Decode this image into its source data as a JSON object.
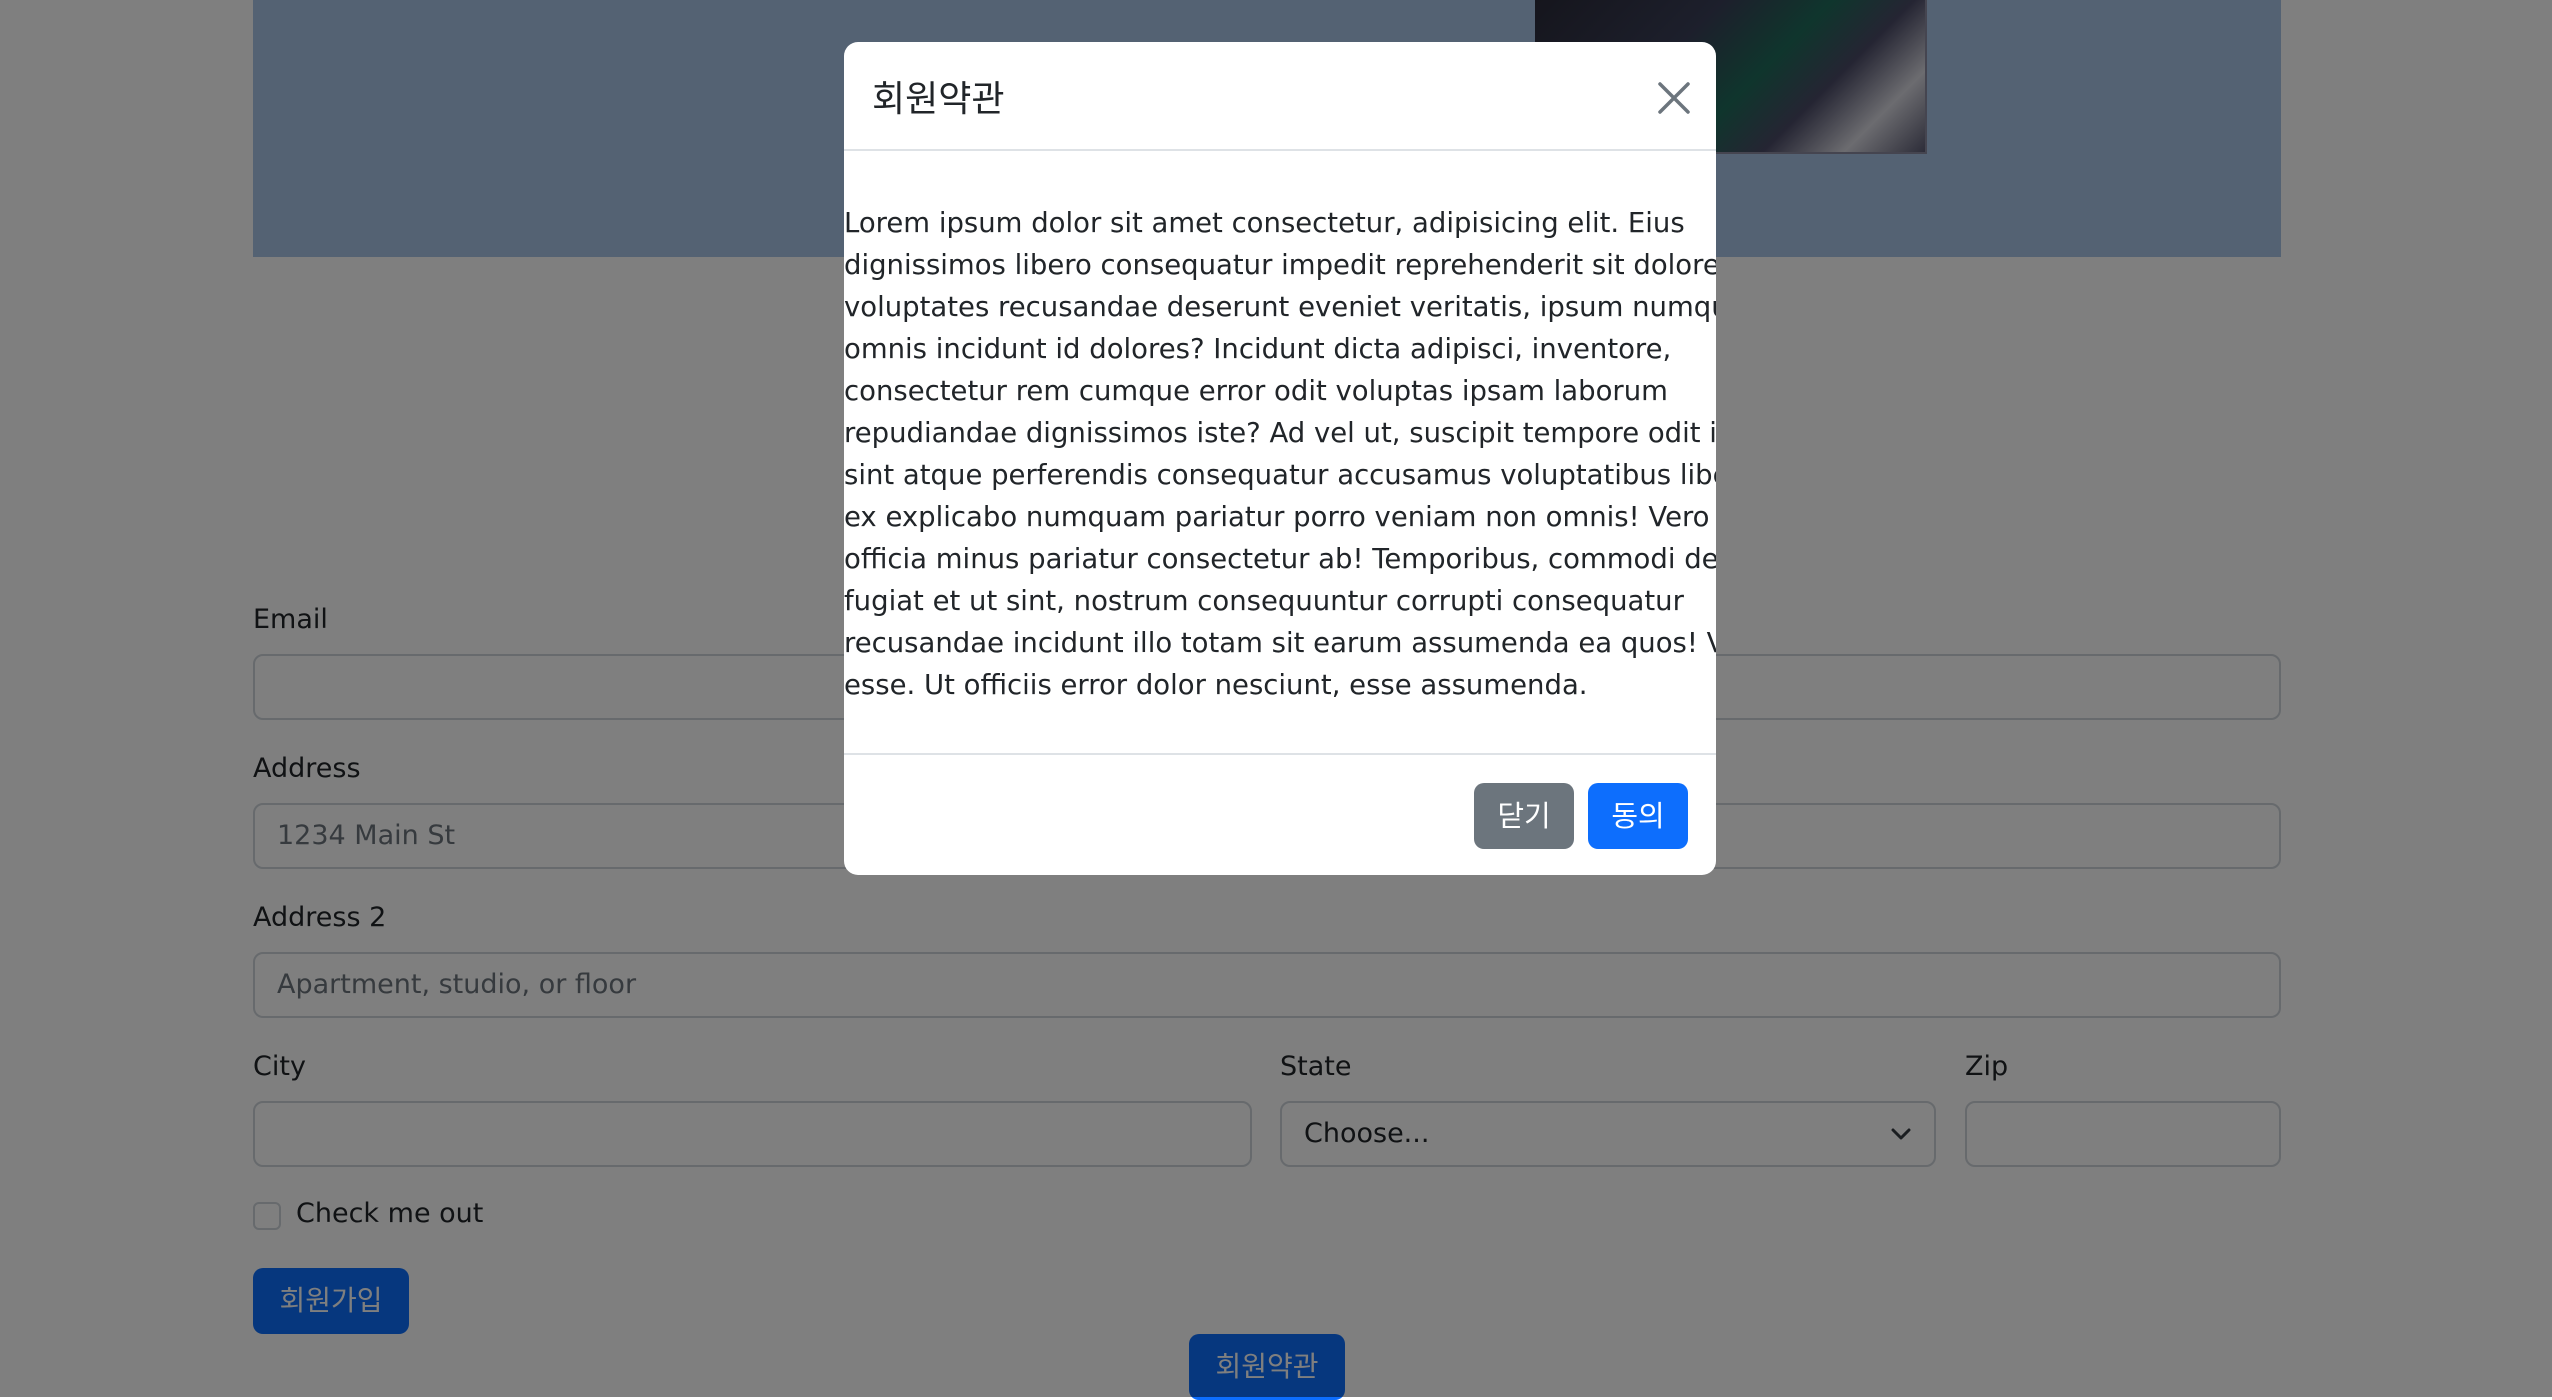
{
  "form": {
    "email_label": "Email",
    "email_value": "",
    "address_label": "Address",
    "address_placeholder": "1234 Main St",
    "address2_label": "Address 2",
    "address2_placeholder": "Apartment, studio, or floor",
    "city_label": "City",
    "city_value": "",
    "state_label": "State",
    "state_selected": "Choose...",
    "zip_label": "Zip",
    "zip_value": "",
    "checkbox_label": "Check me out",
    "checkbox_checked": false,
    "signup_button": "회원가입",
    "terms_button": "회원약관"
  },
  "modal": {
    "title": "회원약관",
    "body_lines": [
      "Lorem ipsum dolor sit amet consectetur, adipisicing elit. Eius",
      "dignissimos libero consequatur impedit reprehenderit sit dolore",
      "voluptates recusandae deserunt eveniet veritatis, ipsum numquam",
      "omnis incidunt id dolores? Incidunt dicta adipisci, inventore,",
      "consectetur rem cumque error odit voluptas ipsam laborum",
      "repudiandae dignissimos iste? Ad vel ut, suscipit tempore odit id",
      "sint atque perferendis consequatur accusamus voluptatibus libero",
      "ex explicabo numquam pariatur porro veniam non omnis! Vero odio",
      "officia minus pariatur consectetur ab! Temporibus, commodi deleniti",
      "fugiat et ut sint, nostrum consequuntur corrupti consequatur",
      "recusandae incidunt illo totam sit earum assumenda ea quos! Vel,",
      "esse. Ut officiis error dolor nesciunt, esse assumenda."
    ],
    "close_button": "닫기",
    "agree_button": "동의"
  },
  "icons": {
    "close": "close-icon",
    "select_chevron": "chevron-down-icon"
  },
  "colors": {
    "primary": "#0d6efd",
    "secondary": "#6c757d",
    "hero_background": "#a8c5e6",
    "backdrop": "rgba(0,0,0,0.5)"
  }
}
